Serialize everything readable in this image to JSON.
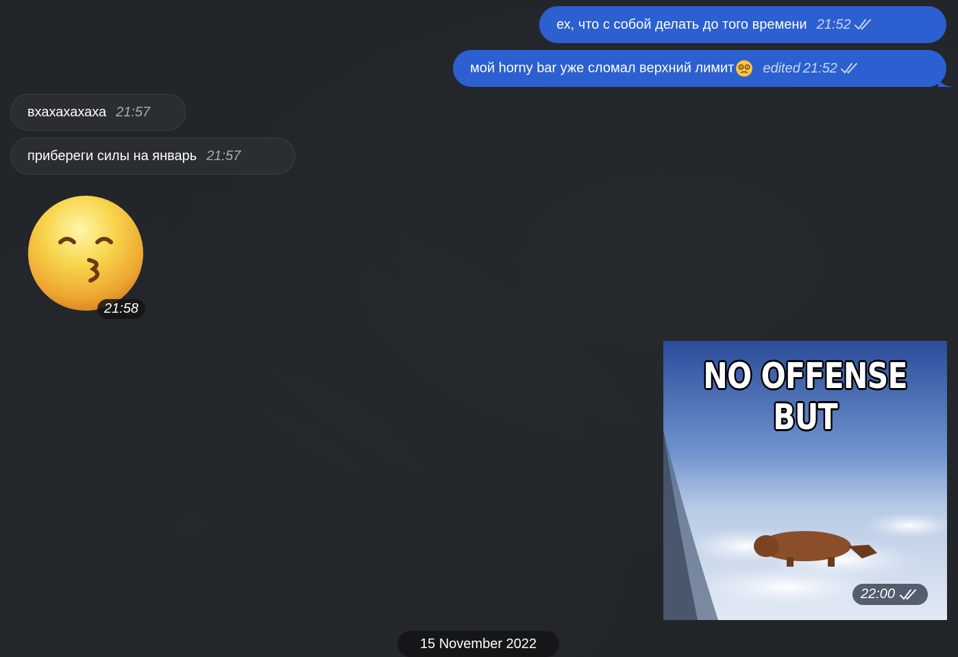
{
  "messages": {
    "out1": {
      "text": "ех, что с собой делать до того времени",
      "time": "21:52"
    },
    "out2": {
      "text": "мой horny bar уже сломал верхний лимит",
      "edited": "edited",
      "time": "21:52"
    },
    "in1": {
      "text": "вхахахахаха",
      "time": "21:57"
    },
    "in2": {
      "text": "прибереги силы на январь",
      "time": "21:57"
    }
  },
  "sticker": {
    "icon": "kissing-face-smiling-eyes",
    "time": "21:58"
  },
  "photo": {
    "caption": "NO OFFENSE BUT",
    "time": "22:00"
  },
  "date_divider": {
    "label": "15 November 2022"
  },
  "colors": {
    "background": "#22262a",
    "outgoing_bubble": "#2c5fcf",
    "incoming_bubble": "#2a2d31"
  }
}
